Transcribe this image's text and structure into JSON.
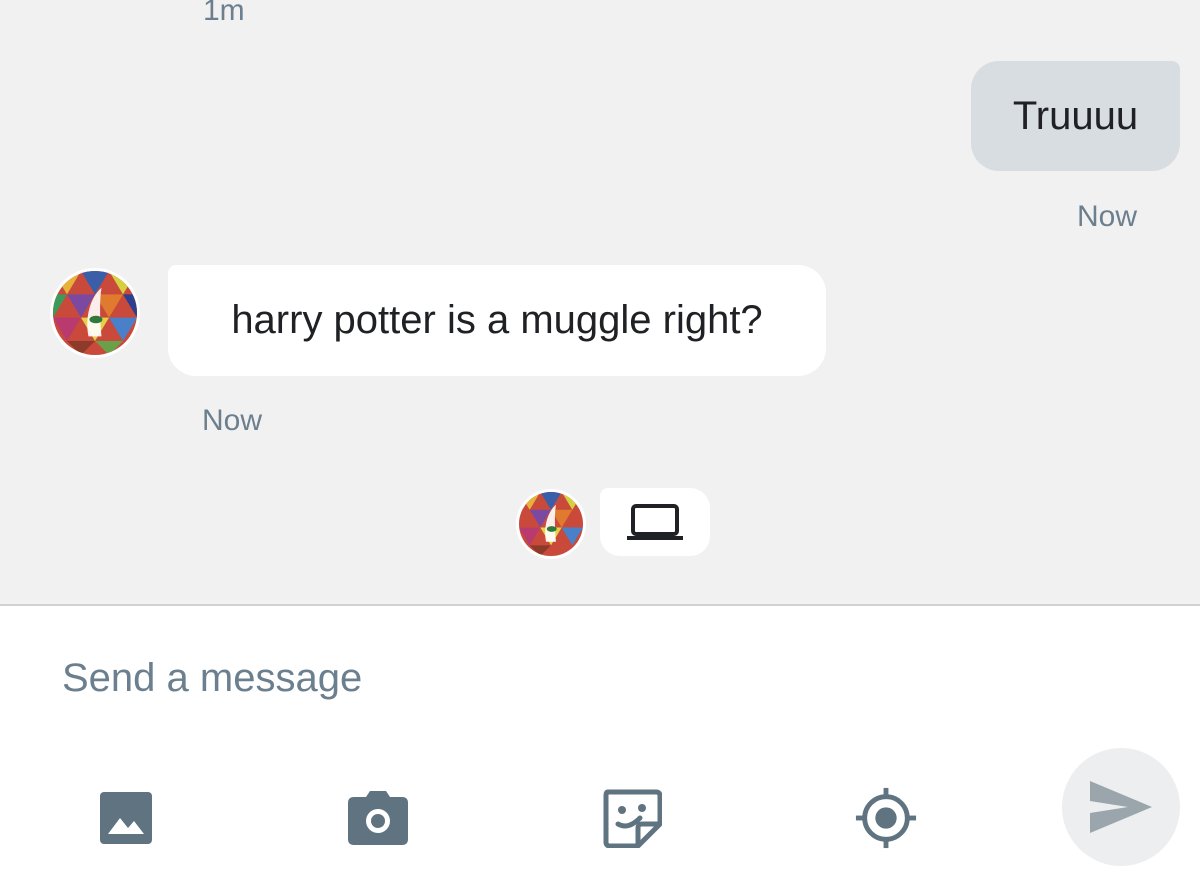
{
  "messages": {
    "prev_timestamp": "1m",
    "outgoing": {
      "text": "Truuuu",
      "timestamp": "Now"
    },
    "incoming": {
      "text": "harry potter is a muggle right?",
      "timestamp": "Now"
    }
  },
  "presence": {
    "device_icon": "laptop-icon"
  },
  "composer": {
    "placeholder": "Send a message",
    "value": "",
    "tools": [
      "image-icon",
      "camera-icon",
      "sticker-icon",
      "location-icon"
    ],
    "send_icon": "send-icon"
  },
  "colors": {
    "chat_background": "#f1f1f1",
    "outgoing_bubble": "#d7dde1",
    "incoming_bubble": "#ffffff",
    "timestamp_text": "#6b7f8e",
    "icon": "#5f7380",
    "send_disabled": "#9aa5ac"
  }
}
